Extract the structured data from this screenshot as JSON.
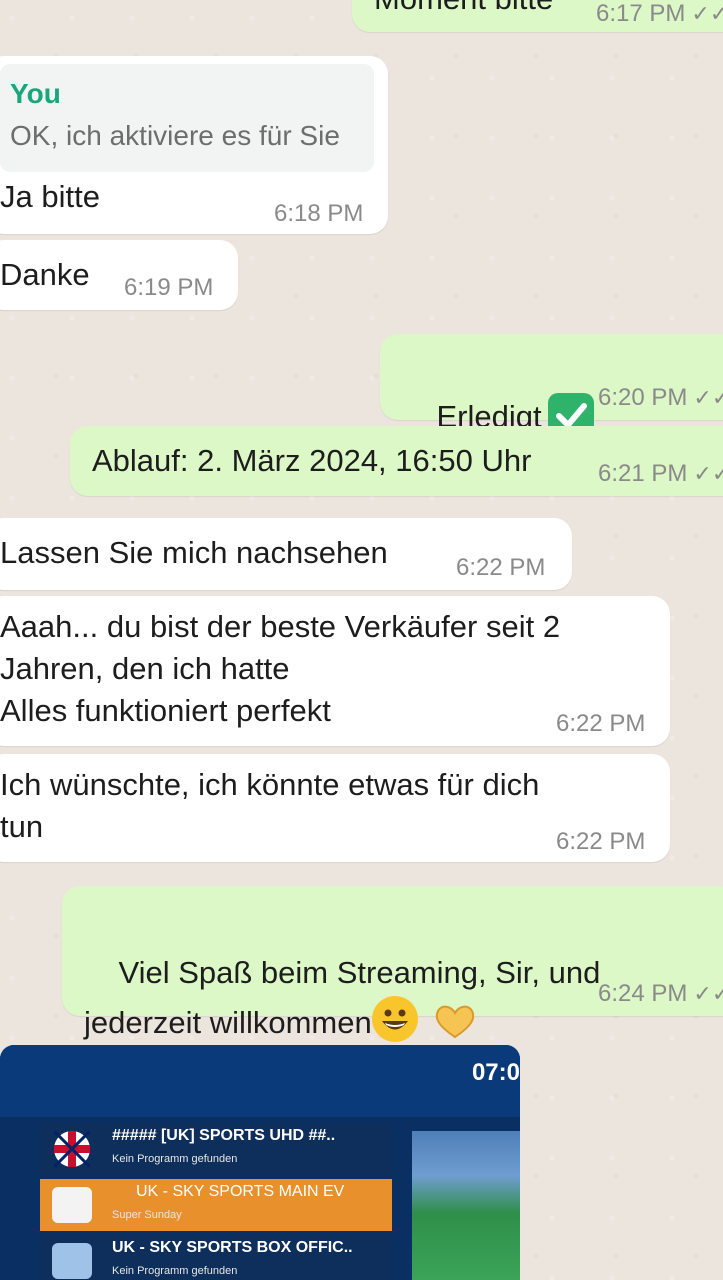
{
  "messages": {
    "m0": {
      "text": "Moment bitte",
      "time": "6:17 PM",
      "ticks": "✓✓"
    },
    "m1": {
      "quote_author": "You",
      "quote_text": "OK, ich aktiviere es für Sie",
      "text": "Ja bitte",
      "time": "6:18 PM"
    },
    "m2": {
      "text": "Danke",
      "time": "6:19 PM"
    },
    "m3": {
      "text": "Erledigt",
      "time": "6:20 PM",
      "ticks": "✓✓"
    },
    "m4": {
      "text": "Ablauf: 2. März 2024, 16:50 Uhr",
      "time": "6:21 PM",
      "ticks": "✓✓"
    },
    "m5": {
      "text": "Lassen Sie mich nachsehen",
      "time": "6:22 PM"
    },
    "m6": {
      "text": "Aaah... du bist der beste Verkäufer seit 2\nJahren, den ich hatte\nAlles funktioniert perfekt",
      "time": "6:22 PM"
    },
    "m7": {
      "text": "Ich wünschte, ich könnte etwas für dich\ntun",
      "time": "6:22 PM"
    },
    "m8": {
      "text": "Viel Spaß beim Streaming, Sir, und\njederzeit willkommen",
      "time": "6:24 PM",
      "ticks": "✓✓"
    }
  },
  "image_message": {
    "clock": "07:0",
    "channels": [
      {
        "name": "##### [UK] SPORTS UHD ##..",
        "sub": "Kein Programm gefunden"
      },
      {
        "name": "UK - SKY SPORTS MAIN EV",
        "sub": "Super Sunday"
      },
      {
        "name": "UK - SKY SPORTS BOX OFFIC..",
        "sub": "Kein Programm gefunden"
      }
    ]
  },
  "colors": {
    "background": "#ece5dd",
    "incoming": "#ffffff",
    "outgoing": "#dcf8c6",
    "quote_author": "#1aa67a",
    "selected_channel": "#e8902c"
  },
  "icons": [
    "check-mark-emoji",
    "grinning-face-emoji",
    "heart-hands-emoji",
    "double-tick-icon"
  ]
}
